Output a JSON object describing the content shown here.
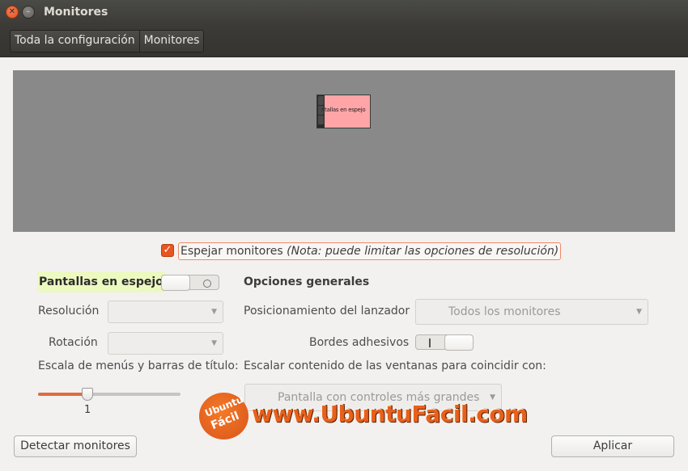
{
  "window": {
    "title": "Monitores"
  },
  "breadcrumb": [
    "Toda la configuración",
    "Monitores"
  ],
  "display_preview": {
    "monitor_label": "ntallas en espejo"
  },
  "mirror": {
    "checked": true,
    "label": "Espejar monitores",
    "note": "(Nota: puede limitar las opciones de resolución)"
  },
  "left": {
    "monitor_name": "Pantallas en espejo",
    "monitor_switch_on": false,
    "resolution_label": "Resolución",
    "resolution_value": "",
    "rotation_label": "Rotación",
    "rotation_value": "",
    "scale_label": "Escala de menús y barras de título:",
    "scale_value": "1",
    "scale_fraction": 0.35
  },
  "right": {
    "heading": "Opciones generales",
    "launcher_label": "Posicionamiento del lanzador",
    "launcher_value": "Todos los monitores",
    "sticky_label": "Bordes adhesivos",
    "sticky_on": true,
    "scale_label": "Escalar contenido de las ventanas para coincidir con:",
    "scale_value": "Pantalla con controles más grandes"
  },
  "buttons": {
    "detect": "Detectar monitores",
    "apply": "Aplicar"
  },
  "watermark": {
    "logo_line1": "Ubuntu",
    "logo_line2": "Fácil",
    "text": "www.UbuntuFacil.com"
  },
  "colors": {
    "accent": "#e95420",
    "titlebar": "#3c3b37",
    "preview_bg": "#898989",
    "monitor": "#ffa5a8",
    "highlight": "#ecf9c1"
  }
}
